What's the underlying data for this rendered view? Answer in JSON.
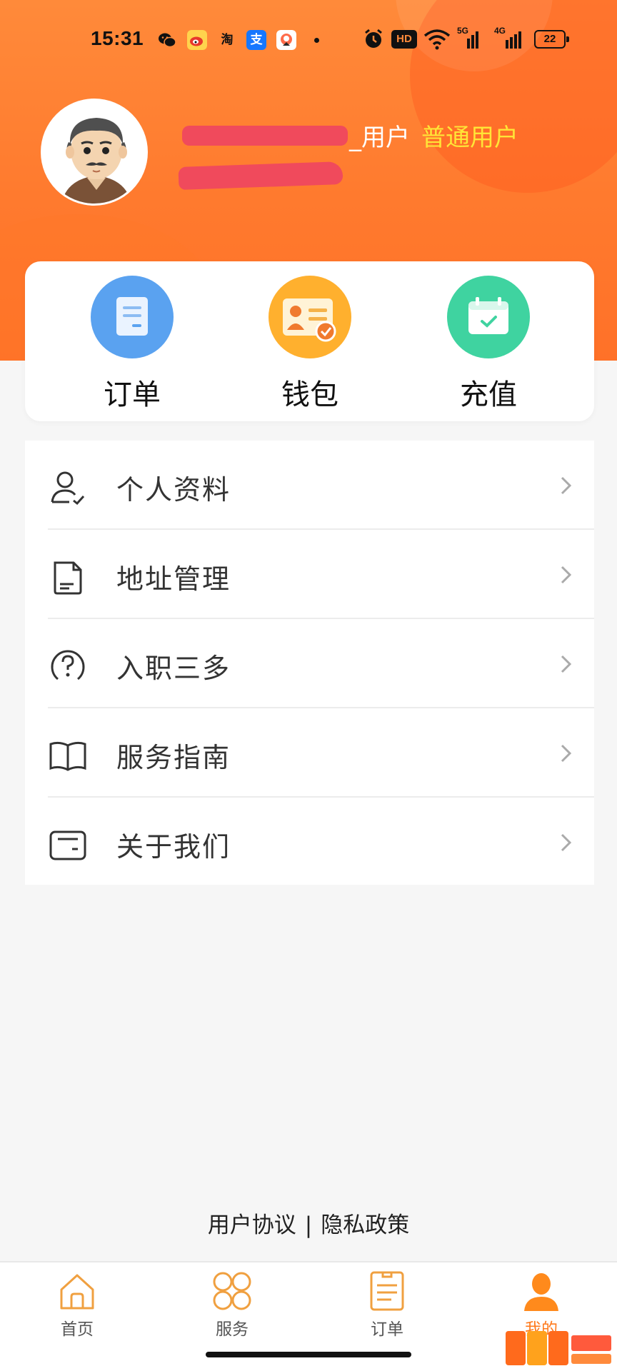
{
  "status_bar": {
    "time": "15:31",
    "apps": [
      {
        "icon": "wechat-icon",
        "label": ""
      },
      {
        "icon": "weibo-icon",
        "label": ""
      },
      {
        "icon": "taobao-icon",
        "label": "淘"
      },
      {
        "icon": "alipay-icon",
        "label": "支"
      },
      {
        "icon": "app-notification-icon",
        "label": ""
      }
    ],
    "hd_label": "HD",
    "network_5g": "5G",
    "network_4g": "4G",
    "battery": "22"
  },
  "profile": {
    "username_suffix": "_用户",
    "level": "普通用户"
  },
  "quick_actions": [
    {
      "label": "订单",
      "icon": "order-icon",
      "color": "#5aa2f0"
    },
    {
      "label": "钱包",
      "icon": "wallet-card-icon",
      "color": "#ffb02e"
    },
    {
      "label": "充值",
      "icon": "recharge-calendar-icon",
      "color": "#3fd3a0"
    }
  ],
  "menu": [
    {
      "label": "个人资料",
      "icon": "user-profile-icon"
    },
    {
      "label": "地址管理",
      "icon": "document-icon"
    },
    {
      "label": "入职三多",
      "icon": "question-icon"
    },
    {
      "label": "服务指南",
      "icon": "book-icon"
    },
    {
      "label": "关于我们",
      "icon": "card-icon"
    }
  ],
  "footer": {
    "user_agreement": "用户协议",
    "separator": "|",
    "privacy_policy": "隐私政策"
  },
  "tab_bar": {
    "tabs": [
      {
        "label": "首页",
        "icon": "home-icon",
        "active": false
      },
      {
        "label": "服务",
        "icon": "services-grid-icon",
        "active": false
      },
      {
        "label": "订单",
        "icon": "order-list-icon",
        "active": false
      },
      {
        "label": "我的",
        "icon": "person-icon",
        "active": true
      }
    ],
    "active_color": "#ff7a1c"
  },
  "colors": {
    "header_orange": "#ff7a2e",
    "level_yellow": "#ffe537",
    "redaction": "#f04a5c"
  }
}
